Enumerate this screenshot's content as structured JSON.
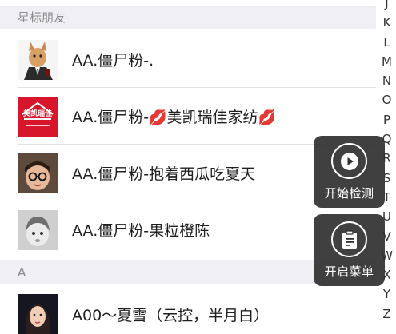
{
  "sections": [
    {
      "header": "星标朋友"
    },
    {
      "header": "A"
    }
  ],
  "contacts": [
    {
      "name_prefix": "AA.僵尸粉-.",
      "name_middle": "",
      "avatar_icon": "cat-in-suit-avatar-icon"
    },
    {
      "name_prefix": "AA.僵尸粉-",
      "lips_icon": "💋",
      "name_middle": "美凯瑞佳家纺",
      "lips_icon_end": "💋",
      "avatar_text": "美凯瑞佳",
      "avatar_icon": "meikai-brand-logo-icon"
    },
    {
      "name_prefix": "AA.僵尸粉-抱着西瓜吃夏天",
      "avatar_icon": "boy-with-glasses-avatar-icon"
    },
    {
      "name_prefix": "AA.僵尸粉-果粒橙陈",
      "avatar_icon": "child-avatar-icon"
    },
    {
      "name_prefix": "A00～夏雪（云控，半月白）",
      "avatar_icon": "woman-avatar-icon"
    }
  ],
  "index_letters": [
    "J",
    "K",
    "L",
    "M",
    "N",
    "O",
    "P",
    "Q",
    "R",
    "S",
    "T",
    "U",
    "V",
    "W",
    "X",
    "Y",
    "Z"
  ],
  "floating_buttons": {
    "start_detect": {
      "label": "开始检测",
      "icon": "play-icon"
    },
    "open_menu": {
      "label": "开启菜单",
      "icon": "clipboard-icon"
    }
  },
  "colors": {
    "section_bg": "#efeff4",
    "float_bg": "#303030",
    "lips": "#c4123a",
    "brand_red": "#d8162b"
  }
}
